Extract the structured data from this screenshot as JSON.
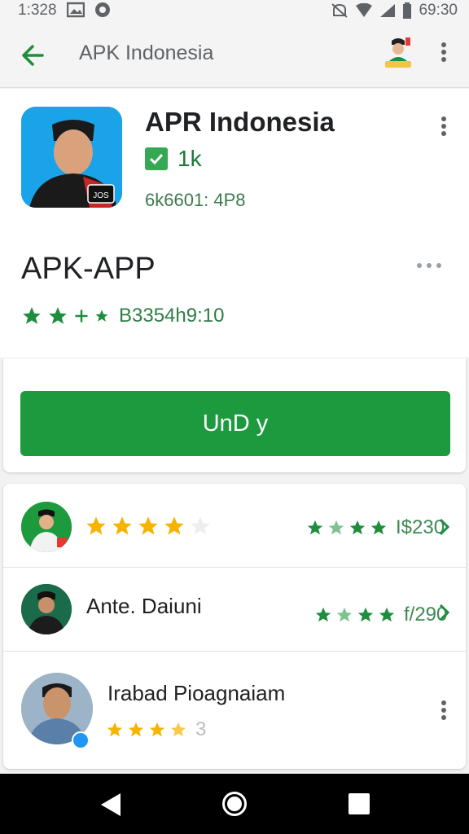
{
  "status_bar": {
    "time": "1:328",
    "clock": "69:30"
  },
  "app_bar": {
    "title": "APK Indonesia"
  },
  "app_info": {
    "name": "APR Indonesia",
    "downloads": "1k",
    "meta": "6k6601: 4P8",
    "section_title": "APK-APP",
    "rating_text": "B3354h9:10",
    "icon_badge": "JOS"
  },
  "action": {
    "install_label": "UnD y"
  },
  "reviews": [
    {
      "name": "",
      "count": "I$230"
    },
    {
      "name": "Ante. Daiuni",
      "count": "f/290"
    },
    {
      "name": "Irabad Pioagnaiam",
      "count": "3"
    }
  ],
  "colors": {
    "accent": "#1e9a3e",
    "star_gold": "#f4b400",
    "star_green": "#1e8e3e"
  }
}
